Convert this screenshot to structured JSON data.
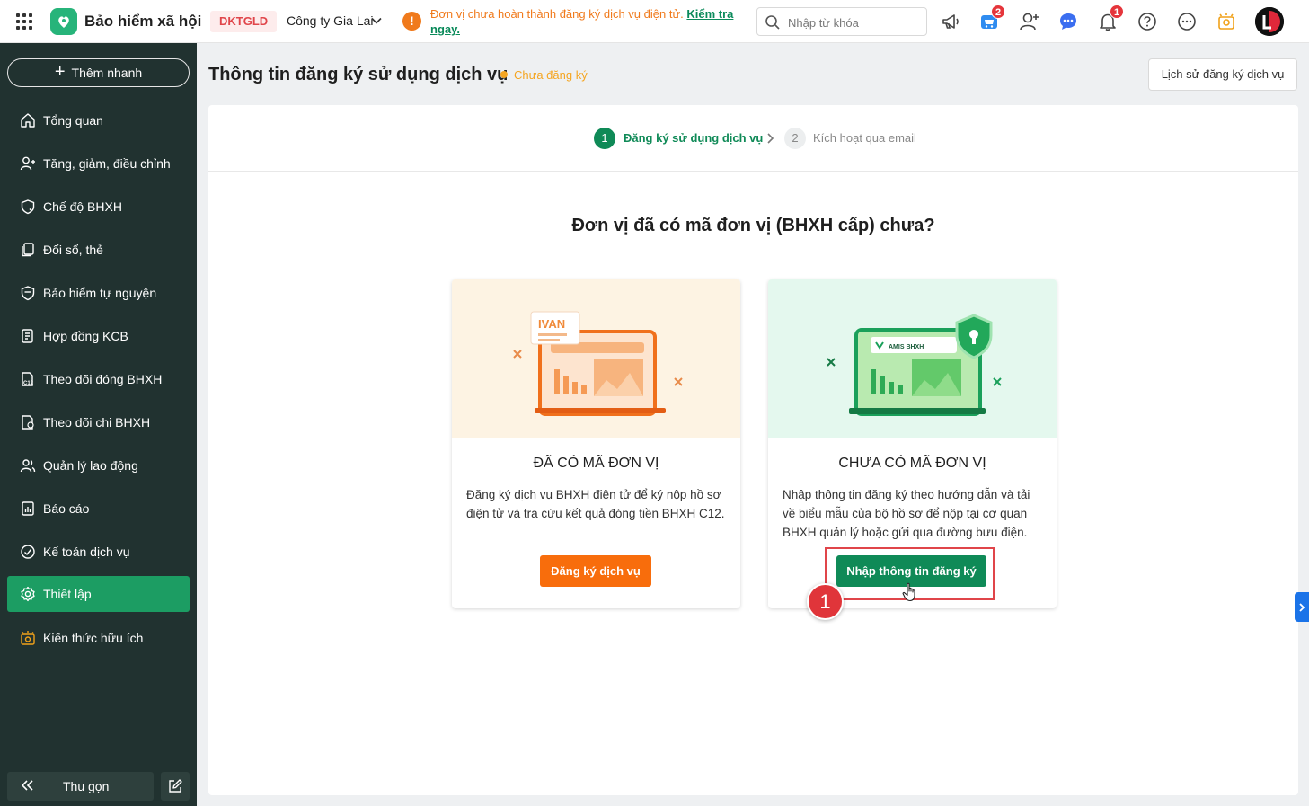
{
  "header": {
    "app_title": "Bảo hiểm xã hội",
    "tenant_code": "DKTGLD",
    "company": "Công ty Gia Lai",
    "warning_text": "Đơn vị chưa hoàn thành đăng ký dịch vụ điện tử. ",
    "warning_link": "Kiểm tra ngay.",
    "search_placeholder": "Nhập từ khóa",
    "cart_badge": "2",
    "notification_badge": "1"
  },
  "sidebar": {
    "quick_add": "Thêm nhanh",
    "items": [
      {
        "label": "Tổng quan",
        "icon": "home-icon"
      },
      {
        "label": "Tăng, giảm, điều chỉnh",
        "icon": "user-adjust-icon"
      },
      {
        "label": "Chế độ BHXH",
        "icon": "policy-icon"
      },
      {
        "label": "Đổi sổ, thẻ",
        "icon": "card-swap-icon"
      },
      {
        "label": "Bảo hiểm tự nguyện",
        "icon": "shield-icon"
      },
      {
        "label": "Hợp đồng KCB",
        "icon": "contract-icon"
      },
      {
        "label": "Theo dõi đóng BHXH",
        "icon": "c12-document-icon"
      },
      {
        "label": "Theo dõi chi BHXH",
        "icon": "payout-document-icon"
      },
      {
        "label": "Quản lý lao động",
        "icon": "people-icon"
      },
      {
        "label": "Báo cáo",
        "icon": "report-icon"
      },
      {
        "label": "Kế toán dịch vụ",
        "icon": "accounting-icon"
      },
      {
        "label": "Thiết lập",
        "icon": "settings-icon",
        "active": true
      },
      {
        "label": "Kiến thức hữu ích",
        "icon": "knowledge-icon"
      }
    ],
    "collapse_label": "Thu gọn"
  },
  "page": {
    "title": "Thông tin đăng ký sử dụng dịch vụ",
    "status": "Chưa đăng ký",
    "history_button": "Lịch sử đăng ký dịch vụ"
  },
  "steps": [
    {
      "number": "1",
      "label": "Đăng ký sử dụng dịch vụ",
      "active": true
    },
    {
      "number": "2",
      "label": "Kích hoạt qua email",
      "active": false
    }
  ],
  "question": "Đơn vị đã có mã đơn vị (BHXH cấp) chưa?",
  "cards": {
    "left": {
      "illustration_label": "IVAN",
      "title": "ĐÃ CÓ MÃ ĐƠN VỊ",
      "description": "Đăng ký dịch vụ BHXH điện tử để ký nộp hồ sơ điện tử và tra cứu kết quả đóng tiền BHXH C12.",
      "button": "Đăng ký dịch vụ"
    },
    "right": {
      "illustration_label": "AMIS BHXH",
      "title": "CHƯA CÓ MÃ ĐƠN VỊ",
      "description": "Nhập thông tin đăng ký theo hướng dẫn và tải về biểu mẫu của bộ hồ sơ để nộp tại cơ quan BHXH quản lý hoặc gửi qua đường bưu điện.",
      "button": "Nhập thông tin đăng ký"
    }
  },
  "annotation": {
    "callout_number": "1"
  },
  "colors": {
    "brand_green": "#0f8a57",
    "sidebar_bg": "#213230",
    "accent_orange": "#f86d0c",
    "highlight_red": "#e0454a"
  }
}
